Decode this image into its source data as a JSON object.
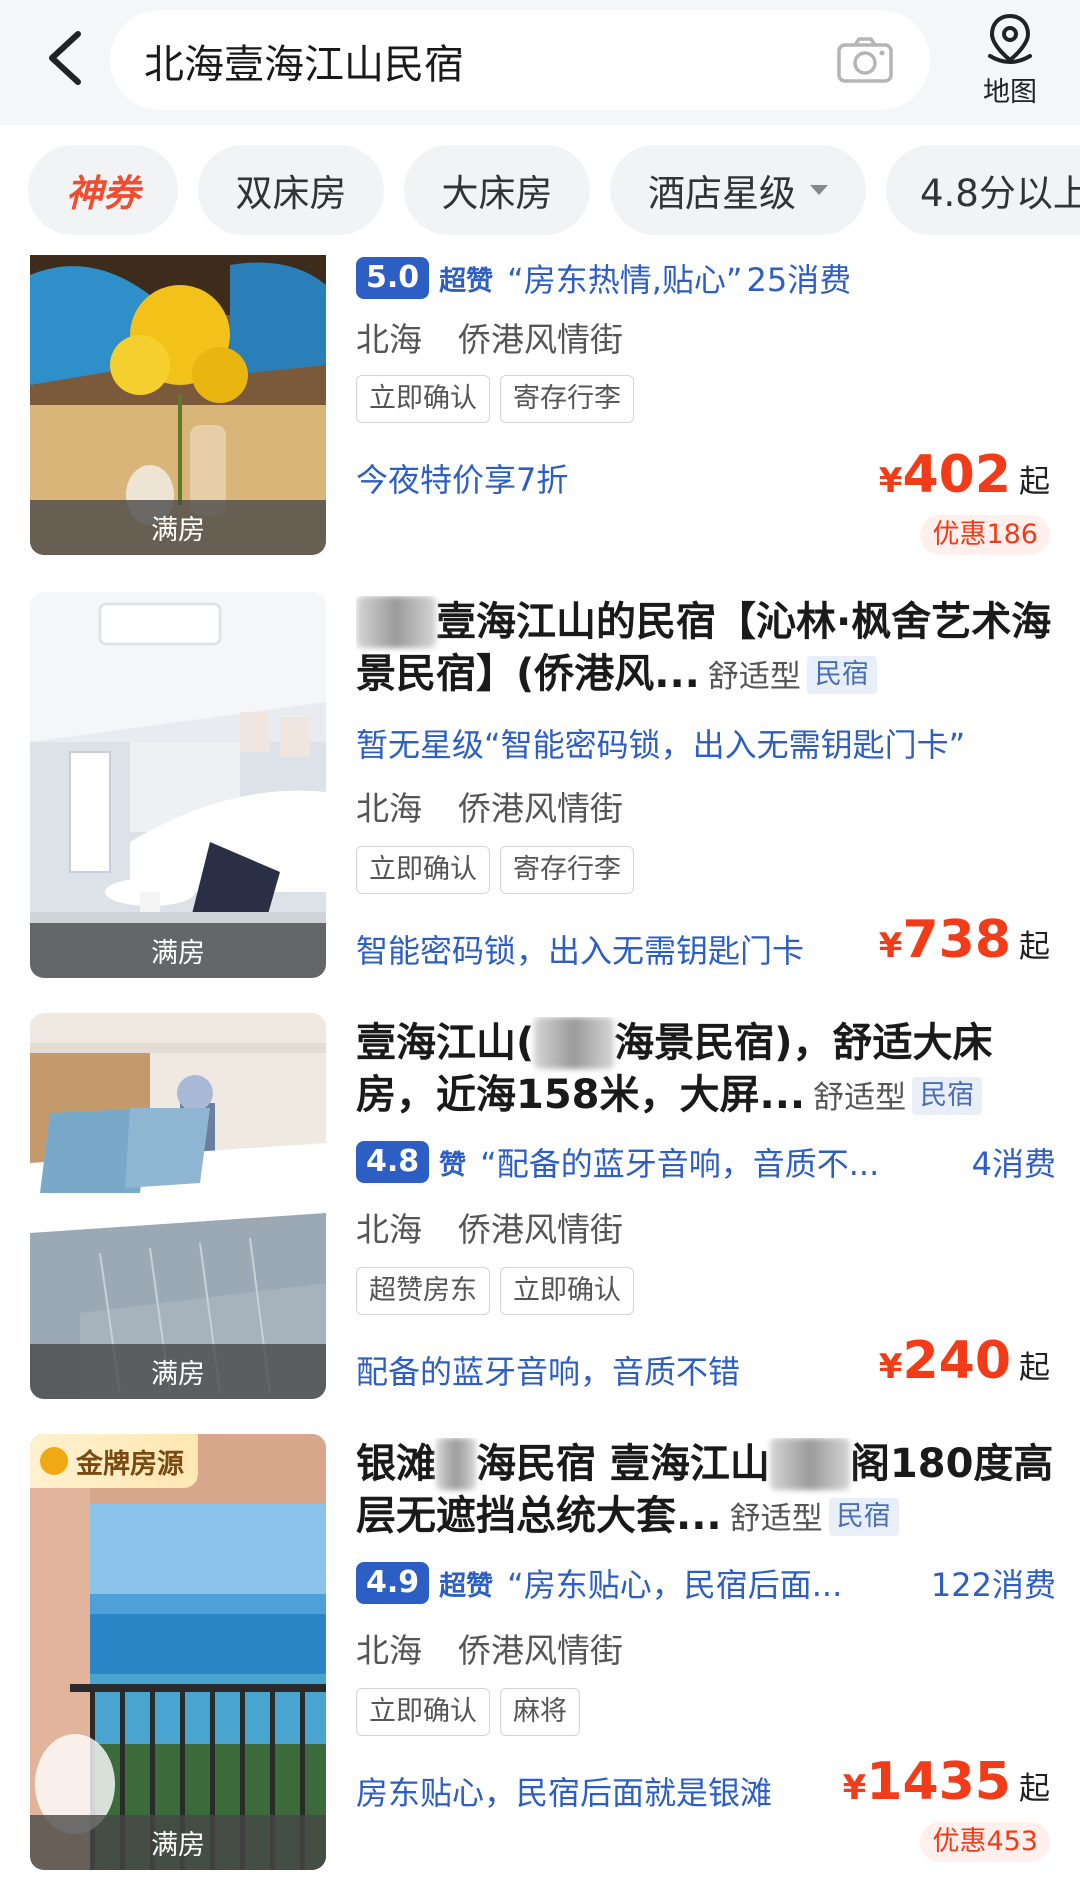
{
  "header": {
    "search_value": "北海壹海江山民宿",
    "map_label": "地图"
  },
  "filters": [
    {
      "label": "神券"
    },
    {
      "label": "双床房"
    },
    {
      "label": "大床房"
    },
    {
      "label": "酒店星级"
    },
    {
      "label": "4.8分以上"
    }
  ],
  "listings": [
    {
      "badge": "满房",
      "rating": "5.0",
      "rating_word": "超赞",
      "quote": "“房东热情,贴心”",
      "review_count": "25消费",
      "area": "北海",
      "street": "侨港风情街",
      "tags": [
        "立即确认",
        "寄存行李"
      ],
      "promo": "今夜特价享7折",
      "currency": "¥",
      "price": "402",
      "price_suffix": "起",
      "discount": "优惠186"
    },
    {
      "badge": "满房",
      "title_prefix": "",
      "title_blur": "和居",
      "title_rest": "壹海江山的民宿【沁林·枫舍艺术海景民宿】(侨港风...",
      "type": "舒适型",
      "type_tag": "民宿",
      "star_line": "暂无星级“智能密码锁，出入无需钥匙门卡”",
      "area": "北海",
      "street": "侨港风情街",
      "tags": [
        "立即确认",
        "寄存行李"
      ],
      "promo": "智能密码锁，出入无需钥匙门卡",
      "currency": "¥",
      "price": "738",
      "price_suffix": "起"
    },
    {
      "badge": "满房",
      "title_prefix": "壹海江山(",
      "title_blur": "和居",
      "title_rest": "海景民宿)，舒适大床房，近海158米，大屏...",
      "type": "舒适型",
      "type_tag": "民宿",
      "rating": "4.8",
      "rating_word": "赞",
      "quote": "“配备的蓝牙音响，音质不...",
      "review_count": "4消费",
      "area": "北海",
      "street": "侨港风情街",
      "tags": [
        "超赞房东",
        "立即确认"
      ],
      "promo": "配备的蓝牙音响，音质不错",
      "currency": "¥",
      "price": "240",
      "price_suffix": "起"
    },
    {
      "badge": "满房",
      "gold_badge": "金牌房源",
      "title_prefix": "银滩",
      "title_blur": "海",
      "title_mid": "海民宿 壹海江山",
      "title_blur2": "观海",
      "title_rest": "阁180度高层无遮挡总统大套...",
      "type": "舒适型",
      "type_tag": "民宿",
      "rating": "4.9",
      "rating_word": "超赞",
      "quote": "“房东贴心，民宿后面...",
      "review_count": "122消费",
      "area": "北海",
      "street": "侨港风情街",
      "tags": [
        "立即确认",
        "麻将"
      ],
      "promo": "房东贴心，民宿后面就是银滩",
      "currency": "¥",
      "price": "1435",
      "price_suffix": "起",
      "discount": "优惠453"
    }
  ]
}
